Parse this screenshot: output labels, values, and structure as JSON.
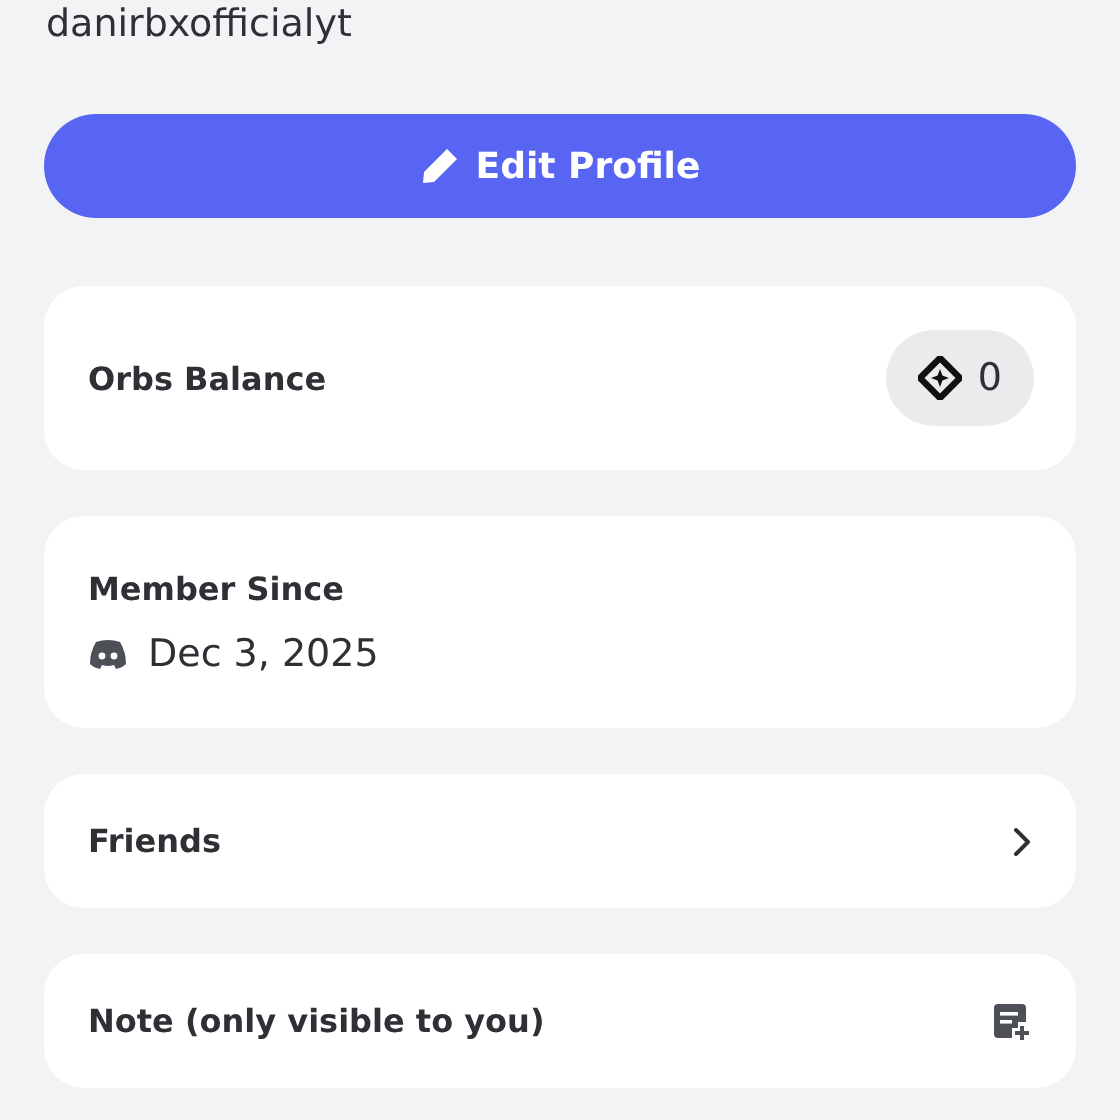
{
  "username": "danirbxofficialyt",
  "edit_button": {
    "label": "Edit Profile"
  },
  "cards": [
    {
      "kind": "balance",
      "label": "Orbs Balance",
      "value": "0"
    },
    {
      "kind": "member",
      "label": "Member Since",
      "value": "Dec 3, 2025"
    },
    {
      "kind": "link",
      "label": "Friends"
    },
    {
      "kind": "note",
      "label": "Note (only visible to you)"
    }
  ]
}
